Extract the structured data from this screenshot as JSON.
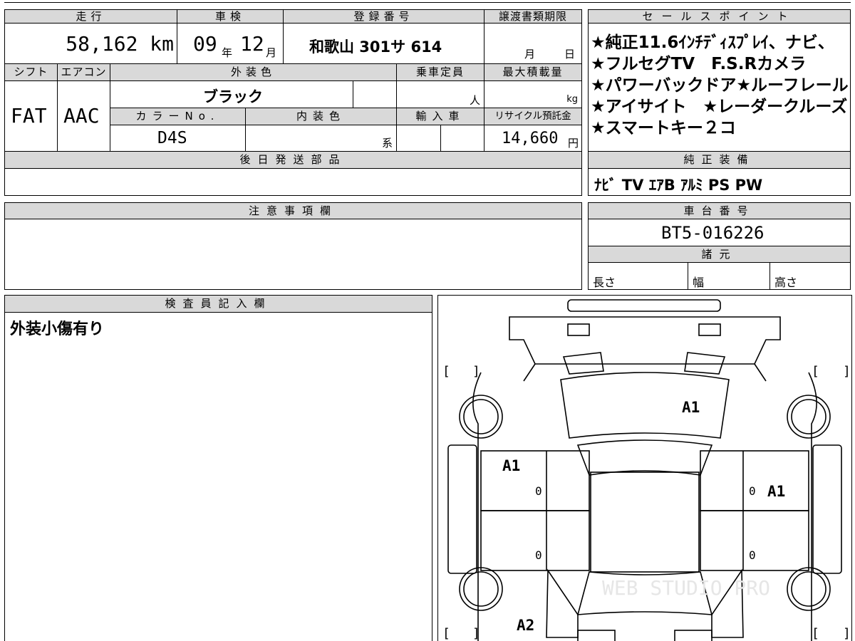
{
  "header": {
    "mileage_label": "走行",
    "inspection_label": "車検",
    "registration_label": "登録番号",
    "transfer_deadline_label": "譲渡書類期限",
    "sales_points_label": "セールスポイント"
  },
  "values": {
    "mileage": "58,162 km",
    "inspection_year": "09",
    "inspection_year_unit": "年",
    "inspection_month": "12",
    "inspection_month_unit": "月",
    "registration_number": "和歌山 301サ 614",
    "transfer_month_unit": "月",
    "transfer_day_unit": "日"
  },
  "row2": {
    "shift_label": "シフト",
    "aircon_label": "エアコン",
    "exterior_color_label": "外装色",
    "capacity_label": "乗車定員",
    "max_load_label": "最大積載量",
    "shift_value": "FAT",
    "aircon_value": "AAC",
    "exterior_color_value": "ブラック",
    "capacity_unit": "人",
    "max_load_unit": "kg",
    "color_no_label": "カラーNo.",
    "interior_color_label": "内装色",
    "import_label": "輸入車",
    "recycle_label": "リサイクル預託金",
    "color_no_value": "D4S",
    "interior_color_unit": "系",
    "recycle_value": "14,660",
    "recycle_unit": "円"
  },
  "sales_points": [
    "★純正11.6ｲﾝﾁﾃﾞｨｽﾌﾟﾚｲ、ナビ、",
    "★フルセグTV　F.S.Rカメラ",
    "★パワーバックドア★ルーフレール",
    "★アイサイト　★レーダークルーズ",
    "★スマートキー２コ"
  ],
  "later_parts_label": "後日発送部品",
  "genuine_equipment": {
    "label": "純正装備",
    "value": "ﾅﾋﾞ TV ｴｱB ｱﾙﾐ PS PW"
  },
  "notes_label": "注意事項欄",
  "chassis": {
    "label": "車台番号",
    "value": "BT5-016226"
  },
  "specs": {
    "label": "諸元",
    "length": "長さ",
    "width": "幅",
    "height": "高さ"
  },
  "inspector": {
    "label": "検査員記入欄",
    "comment": "外装小傷有り"
  },
  "diagram": {
    "marks": [
      "A1",
      "A1",
      "A1",
      "A2"
    ],
    "zeros": [
      "0",
      "0",
      "0",
      "0"
    ],
    "watermark": "WEB STUDIO PRO"
  }
}
